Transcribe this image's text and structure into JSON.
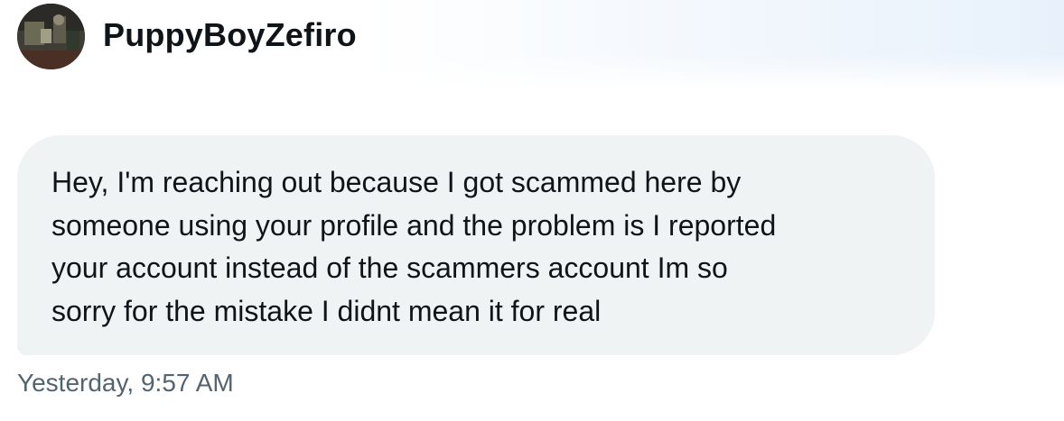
{
  "conversation": {
    "sender_name": "PuppyBoyZefiro",
    "avatar_icon": "user-avatar-photo"
  },
  "message": {
    "lines": [
      "Hey, I'm reaching out because I got scammed here by",
      "someone using your profile and the problem is I reported",
      "your account instead of the scammers account Im so",
      "sorry for the mistake I didnt mean it for real"
    ],
    "timestamp": "Yesterday, 9:57 AM"
  },
  "colors": {
    "bubble_background": "#eff3f4",
    "text_primary": "#0f1419",
    "text_secondary": "#536471"
  }
}
